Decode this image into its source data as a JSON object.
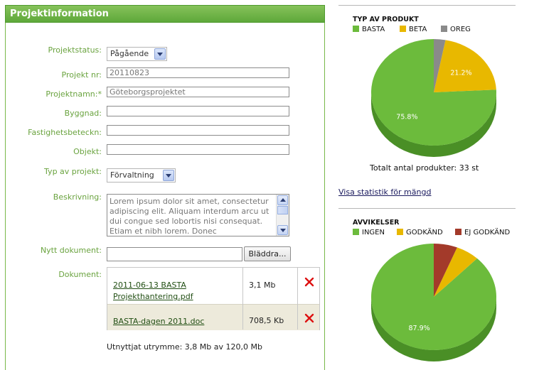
{
  "panel": {
    "title": "Projektinformation"
  },
  "form": {
    "status_label": "Projektstatus:",
    "status_value": "Pågående",
    "projnr_label": "Projekt nr:",
    "projnr_value": "20110823",
    "name_label": "Projektnamn:*",
    "name_value": "Göteborgsprojektet",
    "building_label": "Byggnad:",
    "building_value": "",
    "property_label": "Fastighetsbeteckn:",
    "property_value": "",
    "object_label": "Objekt:",
    "object_value": "",
    "type_label": "Typ av projekt:",
    "type_value": "Förvaltning",
    "desc_label": "Beskrivning:",
    "desc_value": "Lorem ipsum dolor sit amet, consectetur adipiscing elit. Aliquam interdum arcu ut dui congue sed lobortis nisi consequat. Etiam et nibh lorem. Donec",
    "newdoc_label": "Nytt dokument:",
    "browse_label": "Bläddra...",
    "docs_label": "Dokument:",
    "documents": [
      {
        "name": "2011-06-13 BASTA Projekthantering.pdf",
        "size": "3,1 Mb"
      },
      {
        "name": "BASTA-dagen 2011.doc",
        "size": "708,5 Kb"
      }
    ],
    "usage": "Utnyttjat utrymme: 3,8 Mb av 120,0 Mb"
  },
  "colors": {
    "green": "#6cbb3c",
    "green_dark": "#4a8f26",
    "yellow": "#e8b800",
    "yellow_dark": "#b08a00",
    "gray": "#8a8a8a",
    "gray_dark": "#5e5e5e",
    "red": "#a33a2a",
    "red_dark": "#7a2a1e",
    "label_green": "#6aa33f",
    "delete_red": "#d11"
  },
  "chart_data": [
    {
      "type": "pie",
      "title": "TYP AV PRODUKT",
      "categories": [
        "BASTA",
        "BETA",
        "OREG"
      ],
      "values": [
        75.8,
        21.2,
        3.0
      ],
      "labels": [
        "75.8%",
        "21.2%",
        ""
      ],
      "legend": "top"
    },
    {
      "type": "pie",
      "title": "AVVIKELSER",
      "categories": [
        "INGEN",
        "GODKÄND",
        "EJ GODKÄND"
      ],
      "values": [
        87.9,
        6.1,
        6.1
      ],
      "labels": [
        "87.9%",
        "",
        ""
      ],
      "legend": "top"
    }
  ],
  "stats": {
    "total": "Totalt antal produkter: 33 st",
    "link": "Visa statistik för mängd"
  }
}
